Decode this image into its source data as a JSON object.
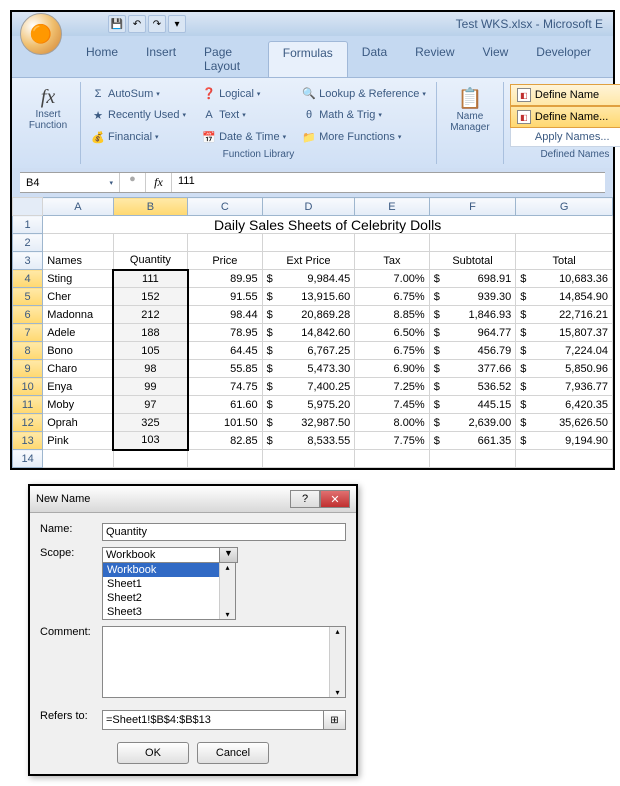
{
  "window_title": "Test WKS.xlsx - Microsoft E",
  "tabs": {
    "home": "Home",
    "insert": "Insert",
    "page_layout": "Page Layout",
    "formulas": "Formulas",
    "data": "Data",
    "review": "Review",
    "view": "View",
    "developer": "Developer"
  },
  "ribbon": {
    "insert_function": "Insert\nFunction",
    "autosum": "AutoSum",
    "recently": "Recently Used",
    "financial": "Financial",
    "logical": "Logical",
    "text": "Text",
    "date_time": "Date & Time",
    "lookup": "Lookup & Reference",
    "math": "Math & Trig",
    "more": "More Functions",
    "fn_lib_label": "Function Library",
    "name_mgr": "Name\nManager",
    "define_name": "Define Name",
    "define_name_menu": "Define Name...",
    "apply_names_menu": "Apply Names...",
    "def_names_label": "Defined Names"
  },
  "name_box": "B4",
  "formula_value": "111",
  "cols": [
    "A",
    "B",
    "C",
    "D",
    "E",
    "F",
    "G"
  ],
  "sheet_title": "Daily Sales Sheets of Celebrity Dolls",
  "headers": {
    "names": "Names",
    "quantity": "Quantity",
    "price": "Price",
    "ext_price": "Ext Price",
    "tax": "Tax",
    "subtotal": "Subtotal",
    "total": "Total"
  },
  "rows": [
    {
      "n": "4",
      "name": "Sting",
      "qty": "111",
      "price": "89.95",
      "ext": "9,984.45",
      "tax": "7.00%",
      "sub": "698.91",
      "tot": "10,683.36"
    },
    {
      "n": "5",
      "name": "Cher",
      "qty": "152",
      "price": "91.55",
      "ext": "13,915.60",
      "tax": "6.75%",
      "sub": "939.30",
      "tot": "14,854.90"
    },
    {
      "n": "6",
      "name": "Madonna",
      "qty": "212",
      "price": "98.44",
      "ext": "20,869.28",
      "tax": "8.85%",
      "sub": "1,846.93",
      "tot": "22,716.21"
    },
    {
      "n": "7",
      "name": "Adele",
      "qty": "188",
      "price": "78.95",
      "ext": "14,842.60",
      "tax": "6.50%",
      "sub": "964.77",
      "tot": "15,807.37"
    },
    {
      "n": "8",
      "name": "Bono",
      "qty": "105",
      "price": "64.45",
      "ext": "6,767.25",
      "tax": "6.75%",
      "sub": "456.79",
      "tot": "7,224.04"
    },
    {
      "n": "9",
      "name": "Charo",
      "qty": "98",
      "price": "55.85",
      "ext": "5,473.30",
      "tax": "6.90%",
      "sub": "377.66",
      "tot": "5,850.96"
    },
    {
      "n": "10",
      "name": "Enya",
      "qty": "99",
      "price": "74.75",
      "ext": "7,400.25",
      "tax": "7.25%",
      "sub": "536.52",
      "tot": "7,936.77"
    },
    {
      "n": "11",
      "name": "Moby",
      "qty": "97",
      "price": "61.60",
      "ext": "5,975.20",
      "tax": "7.45%",
      "sub": "445.15",
      "tot": "6,420.35"
    },
    {
      "n": "12",
      "name": "Oprah",
      "qty": "325",
      "price": "101.50",
      "ext": "32,987.50",
      "tax": "8.00%",
      "sub": "2,639.00",
      "tot": "35,626.50"
    },
    {
      "n": "13",
      "name": "Pink",
      "qty": "103",
      "price": "82.85",
      "ext": "8,533.55",
      "tax": "7.75%",
      "sub": "661.35",
      "tot": "9,194.90"
    }
  ],
  "row14": "14",
  "dialog": {
    "title": "New Name",
    "name_label": "Name:",
    "name_value": "Quantity",
    "scope_label": "Scope:",
    "scope_value": "Workbook",
    "scope_options": [
      "Workbook",
      "Sheet1",
      "Sheet2",
      "Sheet3"
    ],
    "comment_label": "Comment:",
    "refers_label": "Refers to:",
    "refers_value": "=Sheet1!$B$4:$B$13",
    "ok": "OK",
    "cancel": "Cancel"
  }
}
